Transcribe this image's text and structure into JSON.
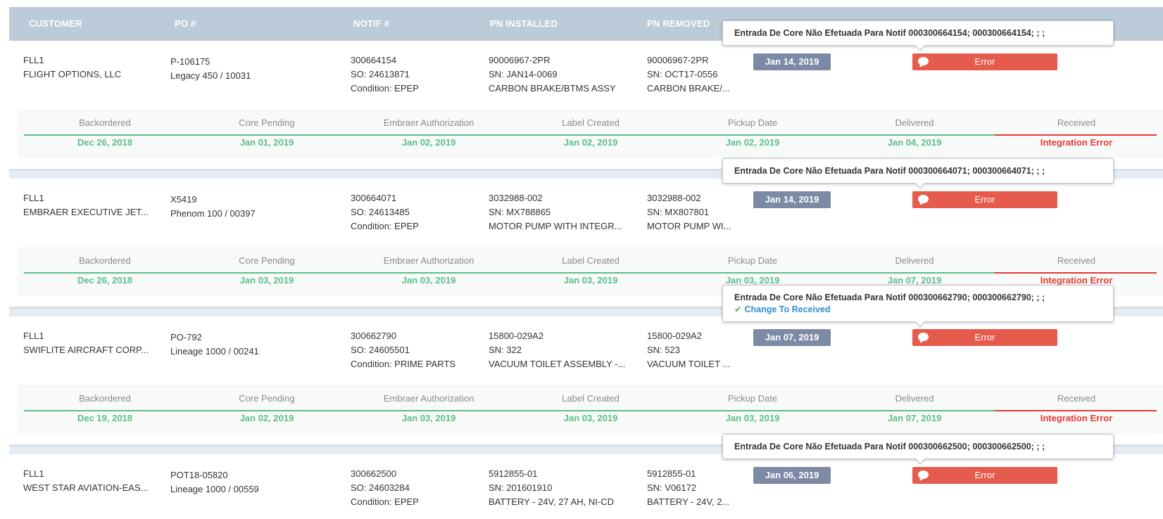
{
  "header": {
    "customer": "CUSTOMER",
    "po": "PO #",
    "notif": "NOTIF #",
    "pn_installed": "PN INSTALLED",
    "pn_removed": "PN REMOVED"
  },
  "stage_labels": [
    "Backordered",
    "Core Pending",
    "Embraer Authorization",
    "Label Created",
    "Pickup Date",
    "Delivered",
    "Received"
  ],
  "colors": {
    "header_bg": "#bccbd9",
    "badge": "#7c8aa6",
    "error": "#e55b4d",
    "ok_green": "#5cbe8a",
    "integration_red": "#e53935",
    "link_blue": "#2f8fd0"
  },
  "icons": {
    "error_button": "comment-icon",
    "tooltip_action": "check-icon"
  },
  "records": [
    {
      "customer_code": "FLL1",
      "customer_name": "FLIGHT OPTIONS, LLC",
      "po": "P-106175",
      "aircraft": "Legacy 450 / 10031",
      "notif": "300664154",
      "so": "SO: 24613871",
      "condition": "Condition: EPEP",
      "installed_pn": "90006967-2PR",
      "installed_sn": "SN: JAN14-0069",
      "installed_desc": "CARBON BRAKE/BTMS ASSY",
      "removed_pn": "90006967-2PR",
      "removed_sn": "SN: OCT17-0556",
      "removed_desc": "CARBON BRAKE/...",
      "date": "Jan 14, 2019",
      "status": "Error",
      "tooltip": "Entrada De Core Não Efetuada Para Notif 000300664154; 000300664154; ; ;",
      "tooltip_action": "",
      "stages": [
        "Dec 26, 2018",
        "Jan 01, 2019",
        "Jan 02, 2019",
        "Jan 02, 2019",
        "Jan 02, 2019",
        "Jan 04, 2019",
        "Integration Error"
      ]
    },
    {
      "customer_code": "FLL1",
      "customer_name": "EMBRAER EXECUTIVE JET...",
      "po": "X5419",
      "aircraft": "Phenom 100 / 00397",
      "notif": "300664071",
      "so": "SO: 24613485",
      "condition": "Condition: EPEP",
      "installed_pn": "3032988-002",
      "installed_sn": "SN: MX788865",
      "installed_desc": "MOTOR PUMP WITH INTEGR...",
      "removed_pn": "3032988-002",
      "removed_sn": "SN: MX807801",
      "removed_desc": "MOTOR PUMP WI...",
      "date": "Jan 14, 2019",
      "status": "Error",
      "tooltip": "Entrada De Core Não Efetuada Para Notif 000300664071; 000300664071; ; ;",
      "tooltip_action": "",
      "stages": [
        "Dec 26, 2018",
        "Jan 03, 2019",
        "Jan 03, 2019",
        "Jan 03, 2019",
        "Jan 03, 2019",
        "Jan 07, 2019",
        "Integration Error"
      ]
    },
    {
      "customer_code": "FLL1",
      "customer_name": "SWIFLITE AIRCRAFT CORP...",
      "po": "PO-792",
      "aircraft": "Lineage 1000 / 00241",
      "notif": "300662790",
      "so": "SO: 24605501",
      "condition": "Condition: PRIME PARTS",
      "installed_pn": "15800-029A2",
      "installed_sn": "SN: 322",
      "installed_desc": "VACUUM TOILET ASSEMBLY -...",
      "removed_pn": "15800-029A2",
      "removed_sn": "SN: 523",
      "removed_desc": "VACUUM TOILET ...",
      "date": "Jan 07, 2019",
      "status": "Error",
      "tooltip": "Entrada De Core Não Efetuada Para Notif 000300662790; 000300662790; ; ;",
      "tooltip_action": "Change To Received",
      "stages": [
        "Dec 19, 2018",
        "Jan 02, 2019",
        "Jan 03, 2019",
        "Jan 03, 2019",
        "Jan 03, 2019",
        "Jan 07, 2019",
        "Integration Error"
      ]
    },
    {
      "customer_code": "FLL1",
      "customer_name": "WEST STAR AVIATION-EAS...",
      "po": "POT18-05820",
      "aircraft": "Lineage 1000 / 00559",
      "notif": "300662500",
      "so": "SO: 24603284",
      "condition": "Condition: EPEP",
      "installed_pn": "5912855-01",
      "installed_sn": "SN: 201601910",
      "installed_desc": "BATTERY - 24V, 27 AH, NI-CD",
      "removed_pn": "5912855-01",
      "removed_sn": "SN: V06172",
      "removed_desc": "BATTERY - 24V, 2...",
      "date": "Jan 06, 2019",
      "status": "Error",
      "tooltip": "Entrada De Core Não Efetuada Para Notif 000300662500; 000300662500; ; ;",
      "tooltip_action": "",
      "stages": []
    }
  ]
}
